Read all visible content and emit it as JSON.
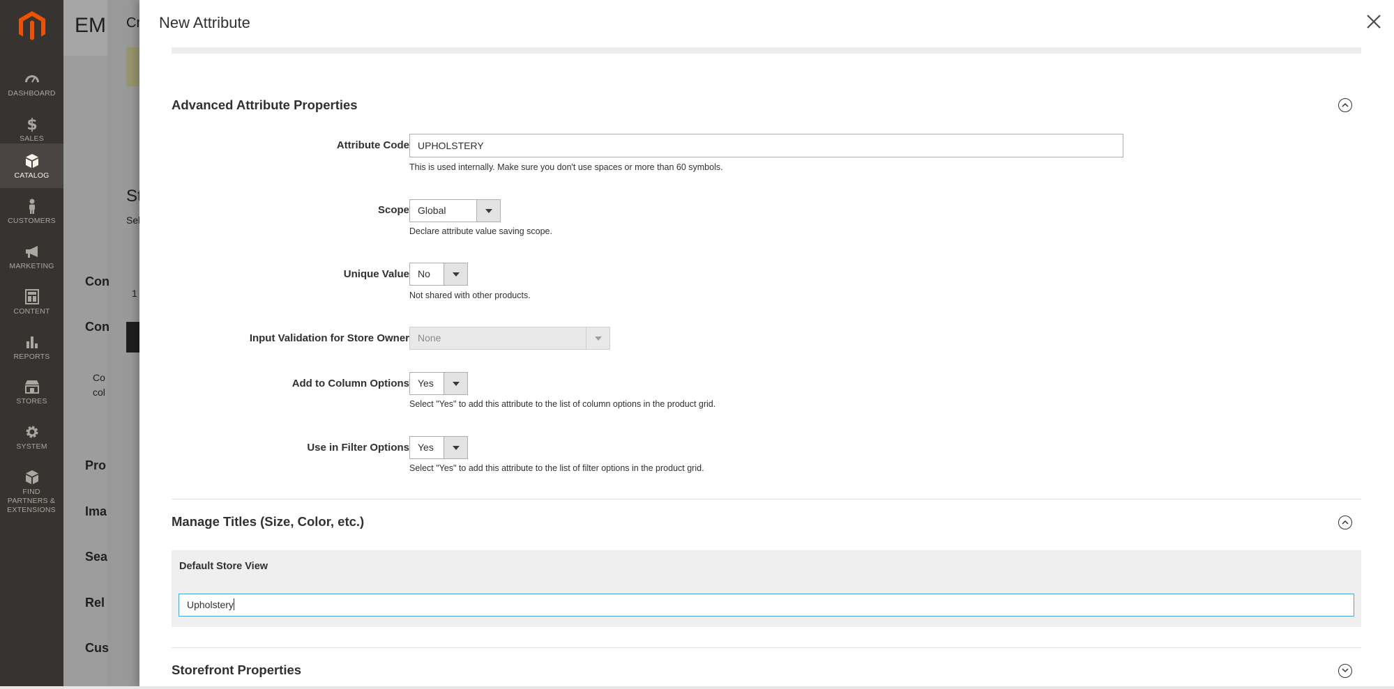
{
  "sidebar": {
    "items": [
      {
        "label": "DASHBOARD",
        "icon": "speedometer-icon"
      },
      {
        "label": "SALES",
        "icon": "dollar-icon"
      },
      {
        "label": "CATALOG",
        "icon": "box-icon"
      },
      {
        "label": "CUSTOMERS",
        "icon": "person-icon"
      },
      {
        "label": "MARKETING",
        "icon": "megaphone-icon"
      },
      {
        "label": "CONTENT",
        "icon": "layout-icon"
      },
      {
        "label": "REPORTS",
        "icon": "bar-chart-icon"
      },
      {
        "label": "STORES",
        "icon": "storefront-icon"
      },
      {
        "label": "SYSTEM",
        "icon": "gear-icon"
      },
      {
        "label": "FIND PARTNERS & EXTENSIONS",
        "icon": "cube-icon"
      }
    ],
    "active": "CATALOG"
  },
  "background_page": {
    "title": "EMI",
    "heading_fragment": "Cr",
    "fragments": [
      "St",
      "Sel",
      "Con",
      "1",
      "Con",
      "Co",
      "col",
      "Pro",
      "Ima",
      "Sea",
      "Rel",
      "Cus"
    ]
  },
  "modal": {
    "title": "New Attribute",
    "close_icon": "close-icon",
    "advanced": {
      "title": "Advanced Attribute Properties",
      "attribute_code": {
        "label": "Attribute Code",
        "value": "UPHOLSTERY",
        "note": "This is used internally. Make sure you don't use spaces or more than 60 symbols."
      },
      "scope": {
        "label": "Scope",
        "value": "Global",
        "note": "Declare attribute value saving scope."
      },
      "unique_value": {
        "label": "Unique Value",
        "value": "No",
        "note": "Not shared with other products."
      },
      "input_validation": {
        "label": "Input Validation for Store Owner",
        "value": "None"
      },
      "column_options": {
        "label": "Add to Column Options",
        "value": "Yes",
        "note": "Select \"Yes\" to add this attribute to the list of column options in the product grid."
      },
      "filter_options": {
        "label": "Use in Filter Options",
        "value": "Yes",
        "note": "Select \"Yes\" to add this attribute to the list of filter options in the product grid."
      }
    },
    "manage_titles": {
      "title": "Manage Titles (Size, Color, etc.)",
      "store_view_label": "Default Store View",
      "store_view_value": "Upholstery"
    },
    "storefront": {
      "title": "Storefront Properties"
    }
  },
  "colors": {
    "sidebar_bg": "#373330",
    "sidebar_active": "#4a4542",
    "logo_orange": "#eb5202",
    "input_focus": "#4ea5d9"
  }
}
